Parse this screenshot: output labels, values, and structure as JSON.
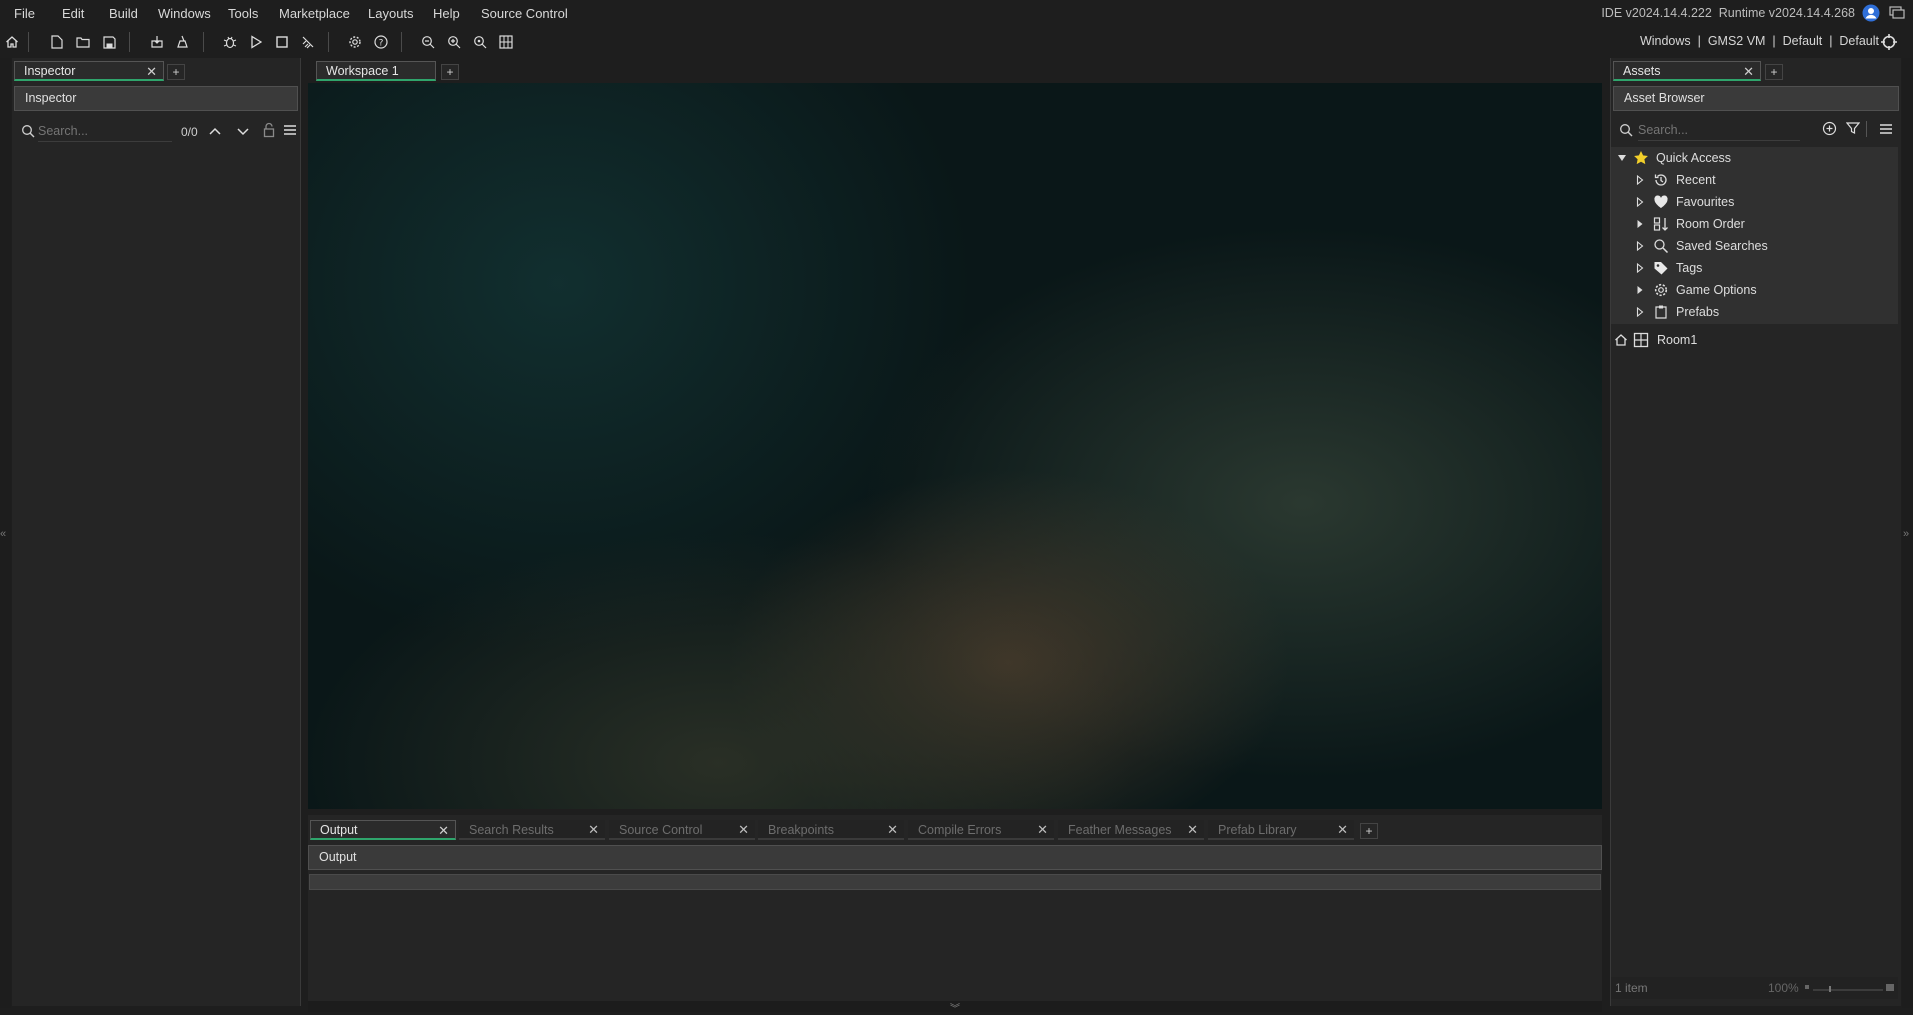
{
  "menu": [
    "File",
    "Edit",
    "Build",
    "Windows",
    "Tools",
    "Marketplace",
    "Layouts",
    "Help",
    "Source Control"
  ],
  "versions": {
    "ide": "IDE v2024.14.4.222",
    "runtime": "Runtime v2024.14.4.268"
  },
  "targets": {
    "platform": "Windows",
    "vm": "GMS2 VM",
    "config": "Default",
    "device": "Default",
    "separator": "|"
  },
  "toolbar_icons": [
    "home-icon",
    "new-project-icon",
    "open-project-icon",
    "save-icon",
    "package-icon",
    "clean-icon",
    "debug-icon",
    "run-icon",
    "stop-icon",
    "clean-build-icon",
    "settings-icon",
    "help-icon",
    "zoom-out-icon",
    "zoom-in-icon",
    "zoom-reset-icon",
    "grid-icon"
  ],
  "inspector": {
    "tab_label": "Inspector",
    "header": "Inspector",
    "search_placeholder": "Search...",
    "match_count": "0/0"
  },
  "workspace": {
    "tab_label": "Workspace 1"
  },
  "output": {
    "tabs": [
      "Output",
      "Search Results",
      "Source Control",
      "Breakpoints",
      "Compile Errors",
      "Feather Messages",
      "Prefab Library"
    ],
    "header": "Output"
  },
  "assets": {
    "tab_label": "Assets",
    "header": "Asset Browser",
    "search_placeholder": "Search...",
    "quick_access": "Quick Access",
    "quick_items": [
      {
        "label": "Recent",
        "icon": "history-icon"
      },
      {
        "label": "Favourites",
        "icon": "heart-icon"
      },
      {
        "label": "Room Order",
        "icon": "room-order-icon"
      },
      {
        "label": "Saved Searches",
        "icon": "search-icon"
      },
      {
        "label": "Tags",
        "icon": "tag-icon"
      },
      {
        "label": "Game Options",
        "icon": "gear-icon"
      },
      {
        "label": "Prefabs",
        "icon": "prefab-icon"
      }
    ],
    "room": "Room1",
    "status_count": "1 item",
    "zoom": "100%"
  },
  "plus_label": "+",
  "close_glyph": "✕",
  "colors": {
    "accent": "#2fa56c",
    "background": "#1e1e1e",
    "panel": "#252525"
  }
}
